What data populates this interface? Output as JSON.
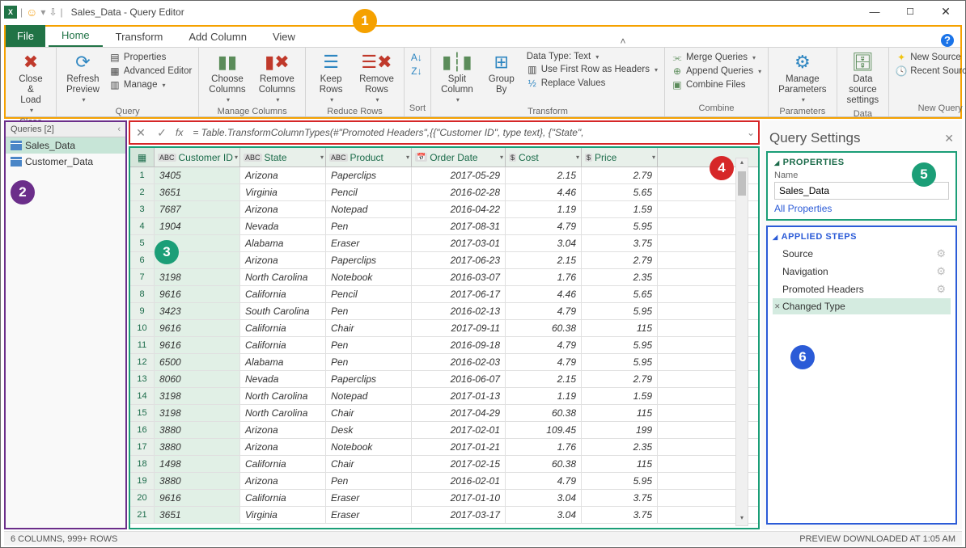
{
  "window": {
    "title": "Sales_Data - Query Editor",
    "sys": {
      "min": "—",
      "max": "☐",
      "close": "✕"
    }
  },
  "tabs": {
    "file": "File",
    "items": [
      "Home",
      "Transform",
      "Add Column",
      "View"
    ],
    "active": "Home"
  },
  "ribbon": {
    "close": {
      "label": "Close &\nLoad",
      "group": "Close"
    },
    "query": {
      "refresh": "Refresh\nPreview",
      "properties": "Properties",
      "advanced": "Advanced Editor",
      "manage": "Manage",
      "group": "Query"
    },
    "manageCols": {
      "choose": "Choose\nColumns",
      "remove": "Remove\nColumns",
      "group": "Manage Columns"
    },
    "reduce": {
      "keep": "Keep\nRows",
      "removeRows": "Remove\nRows",
      "group": "Reduce Rows"
    },
    "sort": {
      "group": "Sort"
    },
    "transform": {
      "split": "Split\nColumn",
      "groupby": "Group\nBy",
      "datatype": "Data Type: Text",
      "firstrow": "Use First Row as Headers",
      "replace": "Replace Values",
      "group": "Transform"
    },
    "combine": {
      "merge": "Merge Queries",
      "append": "Append Queries",
      "files": "Combine Files",
      "group": "Combine"
    },
    "params": {
      "label": "Manage\nParameters",
      "group": "Parameters"
    },
    "datasrc": {
      "label": "Data source\nsettings",
      "group": "Data Sources"
    },
    "newquery": {
      "new": "New Source",
      "recent": "Recent Sources",
      "group": "New Query"
    }
  },
  "queriesPanel": {
    "header": "Queries [2]",
    "items": [
      {
        "name": "Sales_Data",
        "selected": true
      },
      {
        "name": "Customer_Data",
        "selected": false
      }
    ]
  },
  "formula": {
    "text": "= Table.TransformColumnTypes(#\"Promoted Headers\",{{\"Customer ID\", type text}, {\"State\","
  },
  "grid": {
    "columns": [
      "Customer ID",
      "State",
      "Product",
      "Order Date",
      "Cost",
      "Price"
    ],
    "types": [
      "ABC",
      "ABC",
      "ABC",
      "📅",
      "$",
      "$"
    ],
    "rows": [
      [
        "3405",
        "Arizona",
        "Paperclips",
        "2017-05-29",
        "2.15",
        "2.79"
      ],
      [
        "3651",
        "Virginia",
        "Pencil",
        "2016-02-28",
        "4.46",
        "5.65"
      ],
      [
        "7687",
        "Arizona",
        "Notepad",
        "2016-04-22",
        "1.19",
        "1.59"
      ],
      [
        "1904",
        "Nevada",
        "Pen",
        "2017-08-31",
        "4.79",
        "5.95"
      ],
      [
        "",
        "Alabama",
        "Eraser",
        "2017-03-01",
        "3.04",
        "3.75"
      ],
      [
        "",
        "Arizona",
        "Paperclips",
        "2017-06-23",
        "2.15",
        "2.79"
      ],
      [
        "3198",
        "North Carolina",
        "Notebook",
        "2016-03-07",
        "1.76",
        "2.35"
      ],
      [
        "9616",
        "California",
        "Pencil",
        "2017-06-17",
        "4.46",
        "5.65"
      ],
      [
        "3423",
        "South Carolina",
        "Pen",
        "2016-02-13",
        "4.79",
        "5.95"
      ],
      [
        "9616",
        "California",
        "Chair",
        "2017-09-11",
        "60.38",
        "115"
      ],
      [
        "9616",
        "California",
        "Pen",
        "2016-09-18",
        "4.79",
        "5.95"
      ],
      [
        "6500",
        "Alabama",
        "Pen",
        "2016-02-03",
        "4.79",
        "5.95"
      ],
      [
        "8060",
        "Nevada",
        "Paperclips",
        "2016-06-07",
        "2.15",
        "2.79"
      ],
      [
        "3198",
        "North Carolina",
        "Notepad",
        "2017-01-13",
        "1.19",
        "1.59"
      ],
      [
        "3198",
        "North Carolina",
        "Chair",
        "2017-04-29",
        "60.38",
        "115"
      ],
      [
        "3880",
        "Arizona",
        "Desk",
        "2017-02-01",
        "109.45",
        "199"
      ],
      [
        "3880",
        "Arizona",
        "Notebook",
        "2017-01-21",
        "1.76",
        "2.35"
      ],
      [
        "1498",
        "California",
        "Chair",
        "2017-02-15",
        "60.38",
        "115"
      ],
      [
        "3880",
        "Arizona",
        "Pen",
        "2016-02-01",
        "4.79",
        "5.95"
      ],
      [
        "9616",
        "California",
        "Eraser",
        "2017-01-10",
        "3.04",
        "3.75"
      ],
      [
        "3651",
        "Virginia",
        "Eraser",
        "2017-03-17",
        "3.04",
        "3.75"
      ]
    ]
  },
  "querySettings": {
    "title": "Query Settings",
    "props": {
      "header": "PROPERTIES",
      "nameLabel": "Name",
      "name": "Sales_Data",
      "all": "All Properties"
    },
    "steps": {
      "header": "APPLIED STEPS",
      "items": [
        {
          "name": "Source",
          "gear": true
        },
        {
          "name": "Navigation",
          "gear": true
        },
        {
          "name": "Promoted Headers",
          "gear": true
        },
        {
          "name": "Changed Type",
          "gear": false,
          "selected": true
        }
      ]
    }
  },
  "status": {
    "left": "6 COLUMNS, 999+ ROWS",
    "right": "PREVIEW DOWNLOADED AT 1:05 AM"
  }
}
